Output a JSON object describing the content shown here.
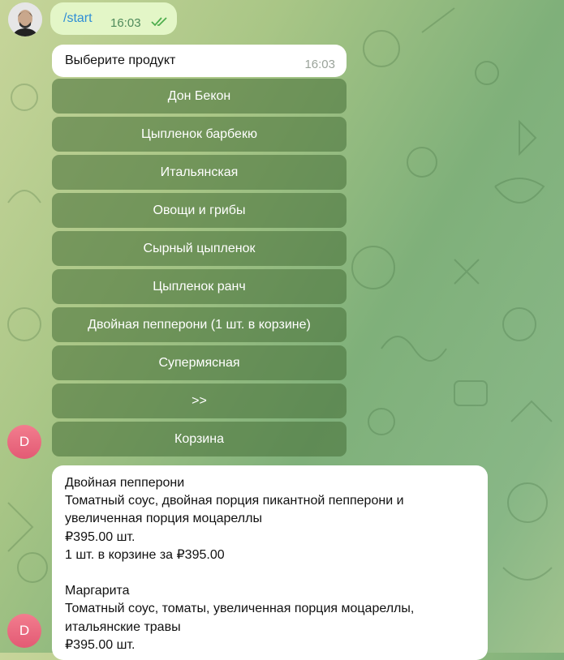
{
  "outgoing": {
    "command": "/start",
    "time": "16:03"
  },
  "bot_prompt": {
    "text": "Выберите продукт",
    "time": "16:03"
  },
  "keyboard": [
    "Дон Бекон",
    "Цыпленок барбекю",
    "Итальянская",
    "Овощи и грибы",
    "Сырный цыпленок",
    "Цыпленок ранч",
    "Двойная пепперони (1 шт. в корзине)",
    "Супермясная",
    ">>",
    "Корзина"
  ],
  "bot_avatar_letter": "D",
  "product_info": {
    "lines": [
      "Двойная пепперони",
      "Томатный соус, двойная порция пикантной пепперони и",
      "увеличенная порция моцареллы",
      "₽395.00 шт.",
      "1 шт. в корзине за ₽395.00",
      "",
      "Маргарита",
      "Томатный соус, томаты, увеличенная порция моцареллы,",
      "итальянские травы",
      "₽395.00 шт."
    ]
  },
  "colors": {
    "outgoing_bubble": "#e3f6c7",
    "link": "#2f8ed6",
    "keyboard_button": "#5f8a4c",
    "avatar": "#e96880"
  }
}
